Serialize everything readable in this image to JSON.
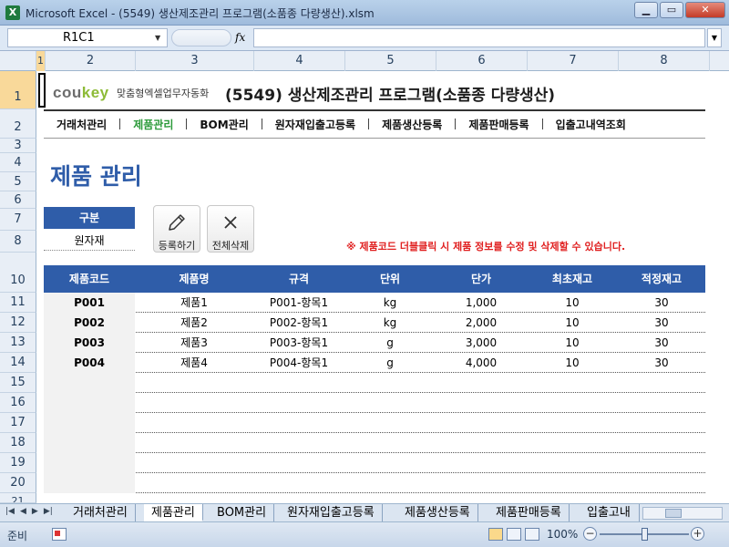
{
  "window": {
    "title": "Microsoft Excel - (5549) 생산제조관리 프로그램(소품종 다량생산).xlsm",
    "app_icon": "X",
    "minimize": "▁",
    "restore": "▭",
    "close": "✕"
  },
  "formula_bar": {
    "name_box": "R1C1",
    "fx": "fx",
    "formula": ""
  },
  "columns": [
    "1",
    "2",
    "3",
    "4",
    "5",
    "6",
    "7",
    "8"
  ],
  "rows": [
    "1",
    "2",
    "3",
    "4",
    "5",
    "6",
    "7",
    "8",
    "10",
    "11",
    "12",
    "13",
    "14",
    "15",
    "16",
    "17",
    "18",
    "19",
    "20",
    "21"
  ],
  "header": {
    "logo_cou": "cou",
    "logo_key": "key",
    "logo_sub": "맞춤형엑셀업무자동화",
    "app_title": "(5549) 생산제조관리 프로그램(소품종 다량생산)"
  },
  "nav": [
    {
      "label": "거래처관리",
      "active": false
    },
    {
      "label": "제품관리",
      "active": true
    },
    {
      "label": "BOM관리",
      "active": false
    },
    {
      "label": "원자재입출고등록",
      "active": false
    },
    {
      "label": "제품생산등록",
      "active": false
    },
    {
      "label": "제품판매등록",
      "active": false
    },
    {
      "label": "입출고내역조회",
      "active": false
    }
  ],
  "page": {
    "title": "제품 관리",
    "category_label": "구분",
    "category_value": "원자재",
    "register_button": "등록하기",
    "delete_all_button": "전체삭제",
    "notice": "※ 제품코드 더블클릭 시 제품 정보를 수정 및 삭제할 수 있습니다."
  },
  "table": {
    "headers": [
      "제품코드",
      "제품명",
      "규격",
      "단위",
      "단가",
      "최초재고",
      "적정재고"
    ],
    "rows": [
      [
        "P001",
        "제품1",
        "P001-항목1",
        "kg",
        "1,000",
        "10",
        "30"
      ],
      [
        "P002",
        "제품2",
        "P002-항목1",
        "kg",
        "2,000",
        "10",
        "30"
      ],
      [
        "P003",
        "제품3",
        "P003-항목1",
        "g",
        "3,000",
        "10",
        "30"
      ],
      [
        "P004",
        "제품4",
        "P004-항목1",
        "g",
        "4,000",
        "10",
        "30"
      ]
    ]
  },
  "sheet_tabs": [
    "거래처관리",
    "제품관리",
    "BOM관리",
    "원자재입출고등록",
    "제품생산등록",
    "제품판매등록",
    "입출고내"
  ],
  "active_sheet_tab": "제품관리",
  "status": {
    "ready": "준비",
    "zoom": "100%",
    "zoom_minus": "−",
    "zoom_plus": "+"
  }
}
